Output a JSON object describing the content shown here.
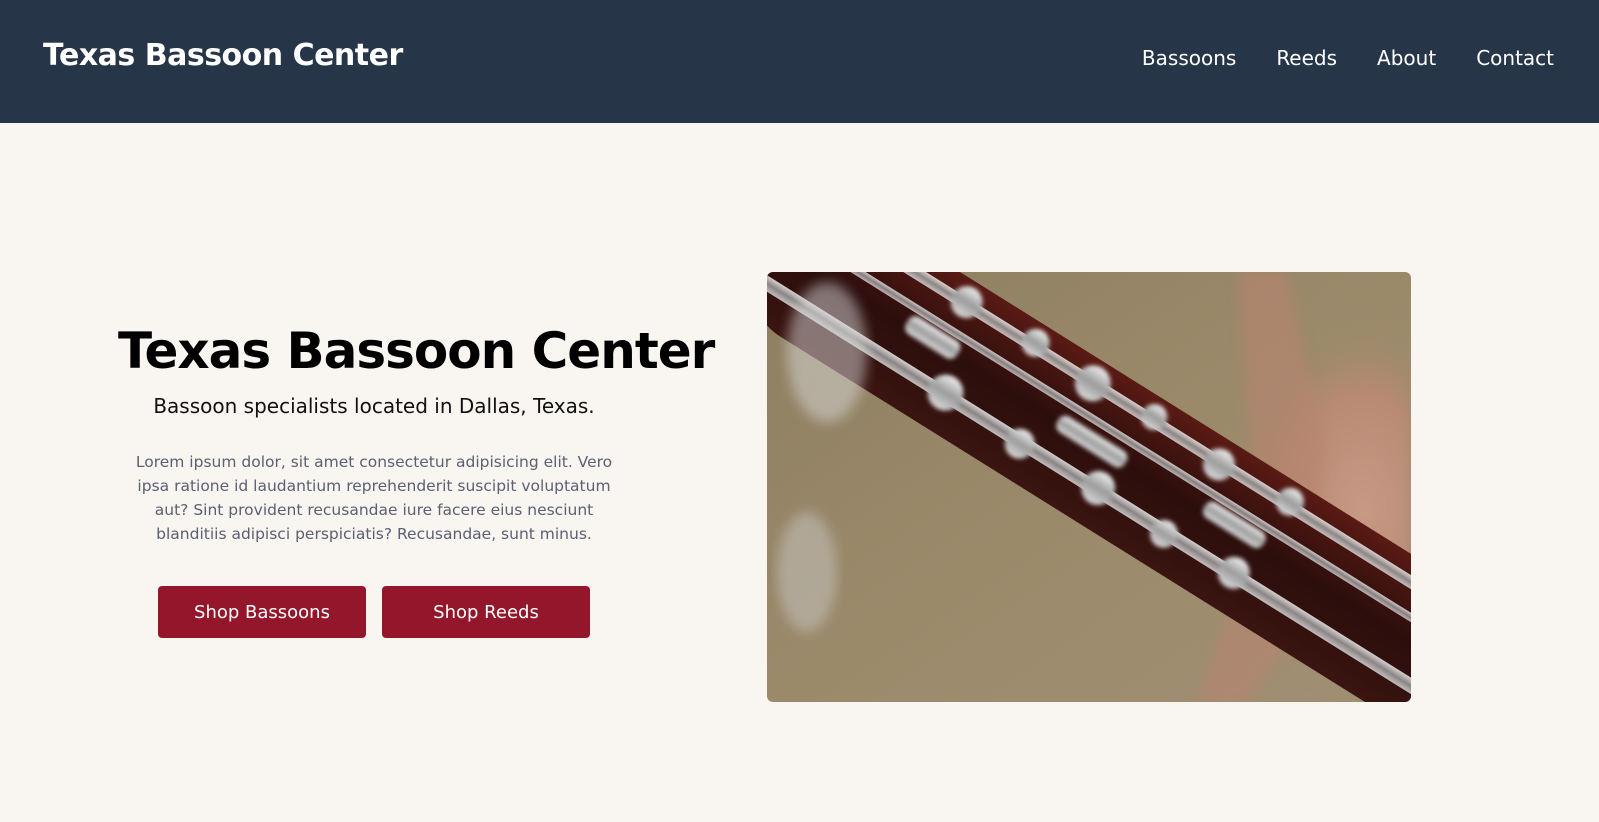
{
  "header": {
    "brand": "Texas Bassoon Center",
    "nav": [
      {
        "label": "Bassoons"
      },
      {
        "label": "Reeds"
      },
      {
        "label": "About"
      },
      {
        "label": "Contact"
      }
    ]
  },
  "hero": {
    "title": "Texas Bassoon Center",
    "subtitle": "Bassoon specialists located in Dallas, Texas.",
    "body": "Lorem ipsum dolor, sit amet consectetur adipisicing elit. Vero ipsa ratione id laudantium reprehenderit suscipit voluptatum aut? Sint provident recusandae iure facere eius nesciunt blanditiis adipisci perspiciatis? Recusandae, sunt minus.",
    "buttons": [
      {
        "label": "Shop Bassoons"
      },
      {
        "label": "Shop Reeds"
      }
    ],
    "image": {
      "subject": "bassoon-keys-photo"
    }
  },
  "colors": {
    "header_bg": "#263547",
    "page_bg": "#f9f5f1",
    "button_bg": "#94162a",
    "button_text": "#ffffff"
  }
}
